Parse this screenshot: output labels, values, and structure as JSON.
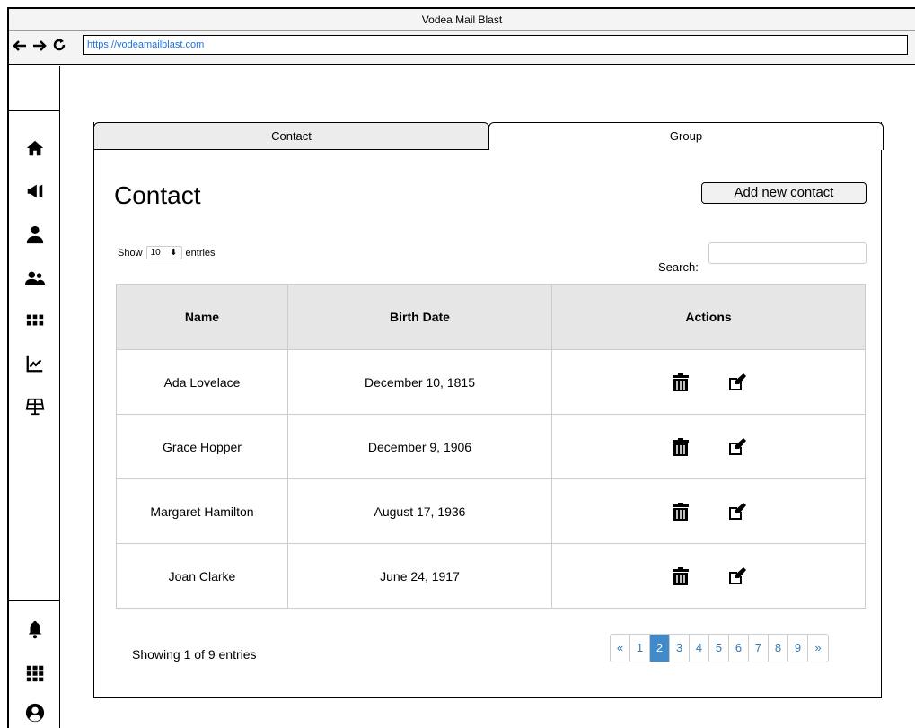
{
  "window": {
    "title": "Vodea Mail Blast"
  },
  "browser": {
    "back_icon": "arrow-left-icon",
    "forward_icon": "arrow-right-icon",
    "reload_icon": "reload-icon",
    "url": "https://vodeamailblast.com"
  },
  "sidebar": {
    "items": [
      {
        "icon": "home-icon"
      },
      {
        "icon": "megaphone-icon"
      },
      {
        "icon": "user-icon"
      },
      {
        "icon": "users-icon"
      },
      {
        "icon": "grid-icon"
      },
      {
        "icon": "chart-icon"
      },
      {
        "icon": "solar-panel-icon"
      }
    ],
    "bottom_items": [
      {
        "icon": "bell-icon"
      },
      {
        "icon": "apps-icon"
      },
      {
        "icon": "account-circle-icon"
      }
    ]
  },
  "tabs": [
    {
      "label": "Contact",
      "active": true
    },
    {
      "label": "Group",
      "active": false
    }
  ],
  "page": {
    "title": "Contact",
    "add_button": "Add new contact",
    "show_label": "Show",
    "show_value": "10",
    "entries_label": "entries",
    "search_label": "Search:",
    "search_value": ""
  },
  "table": {
    "columns": [
      "Name",
      "Birth Date",
      "Actions"
    ],
    "rows": [
      {
        "name": "Ada Lovelace",
        "birth": "December 10, 1815"
      },
      {
        "name": "Grace Hopper",
        "birth": "December 9, 1906"
      },
      {
        "name": "Margaret Hamilton",
        "birth": "August 17, 1936"
      },
      {
        "name": "Joan Clarke",
        "birth": "June 24, 1917"
      }
    ]
  },
  "footer": {
    "showing": "Showing 1 of 9 entries",
    "pagination": [
      "«",
      "1",
      "2",
      "3",
      "4",
      "5",
      "6",
      "7",
      "8",
      "9",
      "»"
    ],
    "active_page": "2"
  },
  "colors": {
    "accent": "#428bca",
    "link": "#337ab7",
    "header_bg": "#e6e6e6"
  }
}
